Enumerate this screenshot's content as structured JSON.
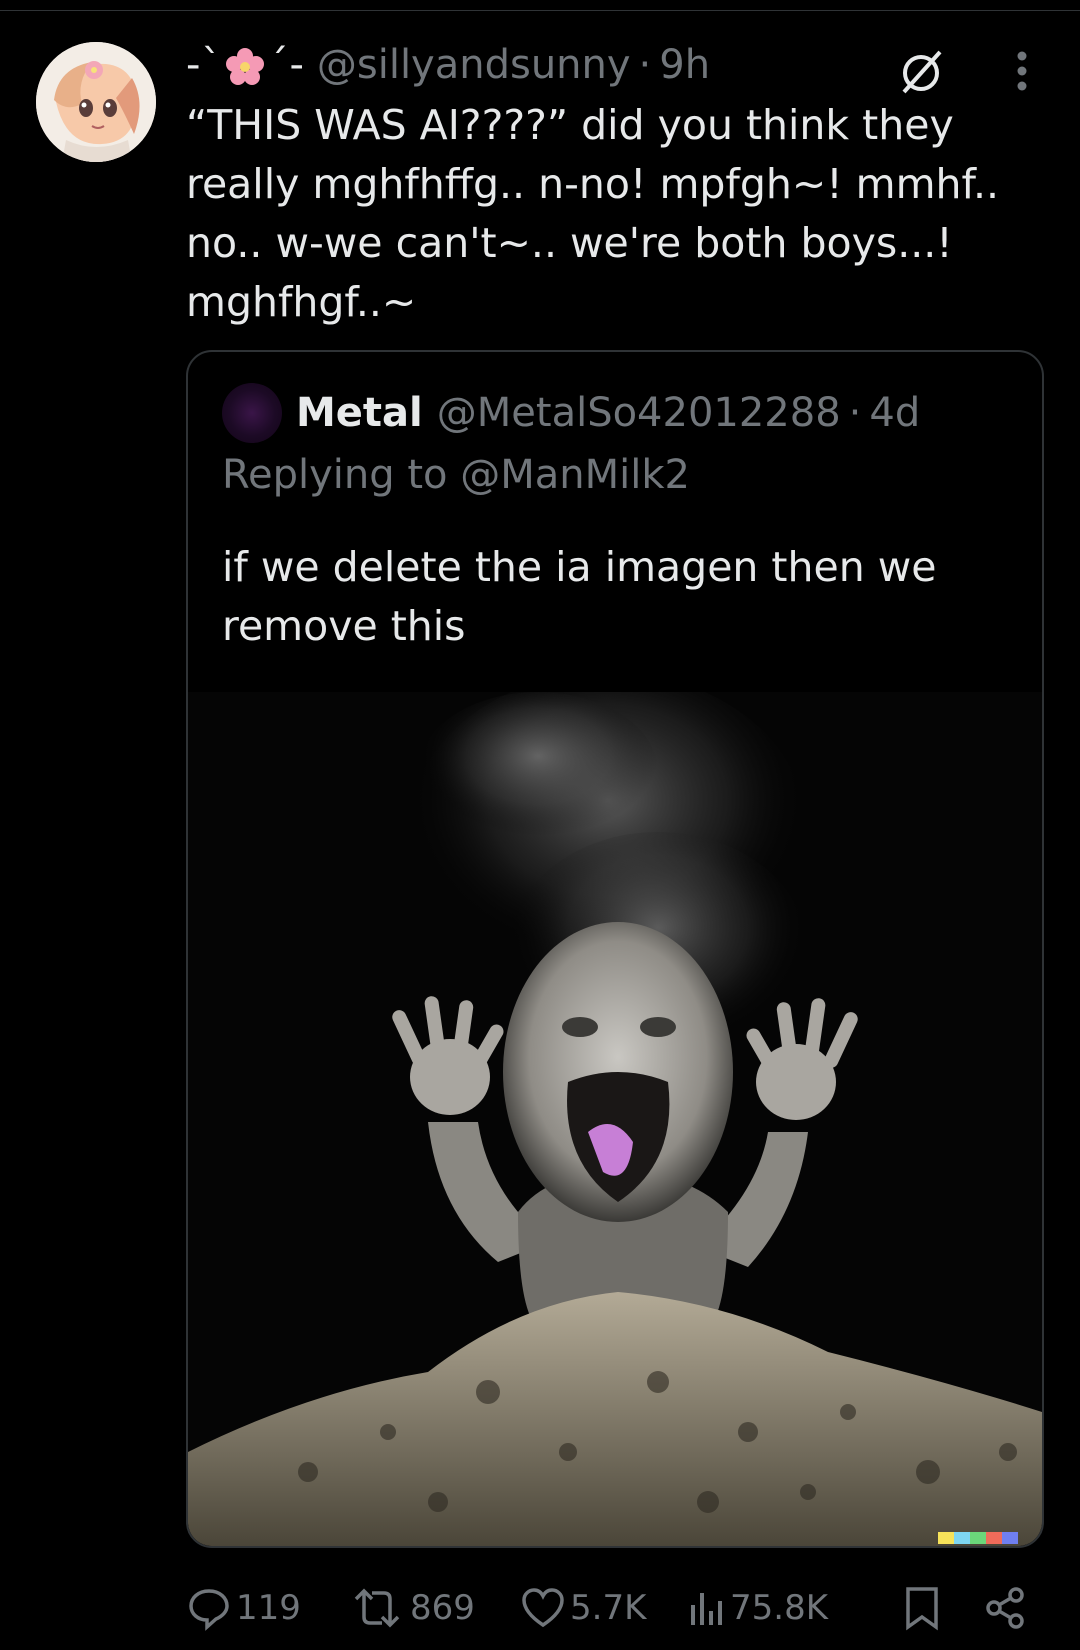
{
  "tweet": {
    "display_name_left": "-`",
    "display_name_right": "´-",
    "handle": "@sillyandsunny",
    "separator": "·",
    "time": "9h",
    "text": "“THIS WAS AI????” did you think they really mghfhffg.. n-no! mpfgh~! mmhf.. no.. w-we can't~.. we're both boys...! mghfhgf..~",
    "hidden_reply_icon": "hidden-reply-icon",
    "more_icon": "more-options-icon"
  },
  "quote": {
    "name": "Metal",
    "handle": "@MetalSo42012288",
    "separator": "·",
    "time": "4d",
    "replying_to": "Replying to @ManMilk2",
    "text": "if we delete the ia imagen then we remove this"
  },
  "actions": {
    "replies": "119",
    "reposts": "869",
    "likes": "5.7K",
    "views": "75.8K"
  },
  "colors": {
    "background": "#000000",
    "text": "#e7e9ea",
    "muted": "#71767b",
    "border": "#2f3336"
  }
}
